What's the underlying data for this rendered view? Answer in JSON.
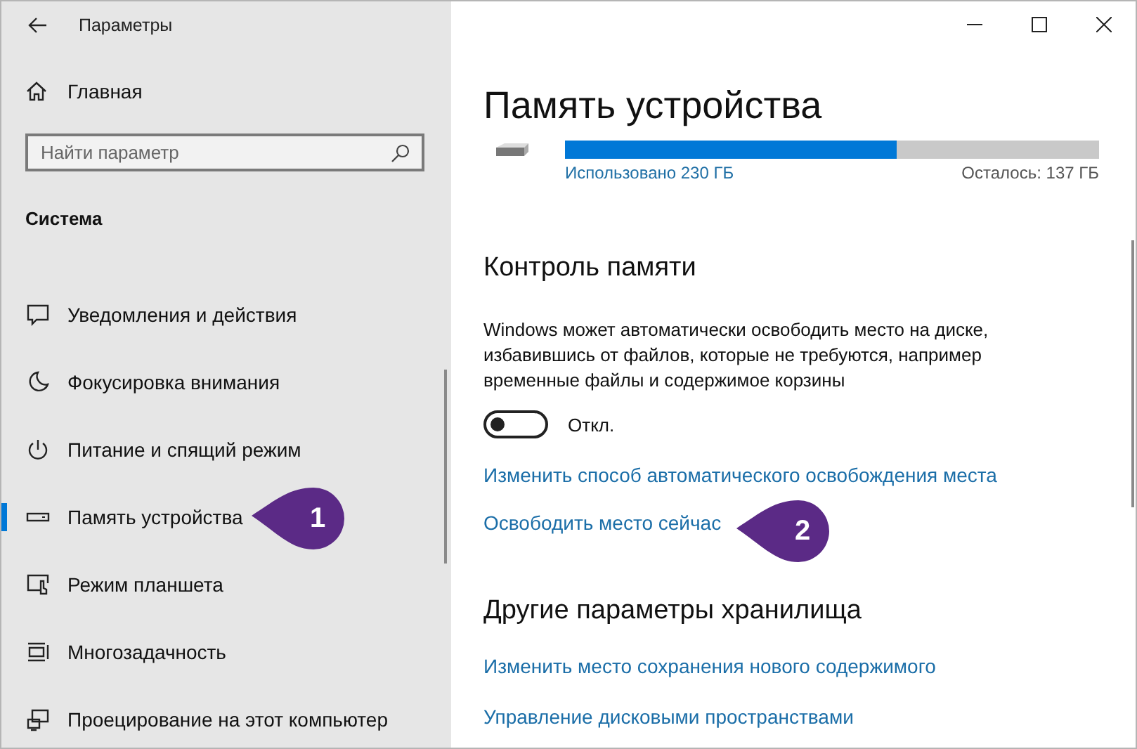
{
  "window": {
    "title": "Параметры"
  },
  "sidebar": {
    "home": "Главная",
    "search": {
      "placeholder": "Найти параметр"
    },
    "section": "Система",
    "items": [
      {
        "label": "Уведомления и действия",
        "selected": false
      },
      {
        "label": "Фокусировка внимания",
        "selected": false
      },
      {
        "label": "Питание и спящий режим",
        "selected": false
      },
      {
        "label": "Память устройства",
        "selected": true
      },
      {
        "label": "Режим планшета",
        "selected": false
      },
      {
        "label": "Многозадачность",
        "selected": false
      },
      {
        "label": "Проецирование на этот компьютер",
        "selected": false
      }
    ]
  },
  "main": {
    "title": "Память устройства",
    "storage": {
      "level": 0.62,
      "used": "Использовано 230 ГБ",
      "free": "Осталось: 137 ГБ"
    },
    "storage_sense": {
      "heading": "Контроль памяти",
      "description": "Windows может автоматически освободить место на диске, избавившись от файлов, которые не требуются, например временные файлы и содержимое корзины",
      "toggle": {
        "on": false,
        "label": "Откл."
      },
      "links": [
        "Изменить способ автоматического освобождения места",
        "Освободить место сейчас"
      ]
    },
    "other": {
      "heading": "Другие параметры хранилища",
      "links": [
        "Изменить место сохранения нового содержимого",
        "Управление дисковыми пространствами"
      ]
    }
  },
  "callouts": [
    "1",
    "2"
  ]
}
